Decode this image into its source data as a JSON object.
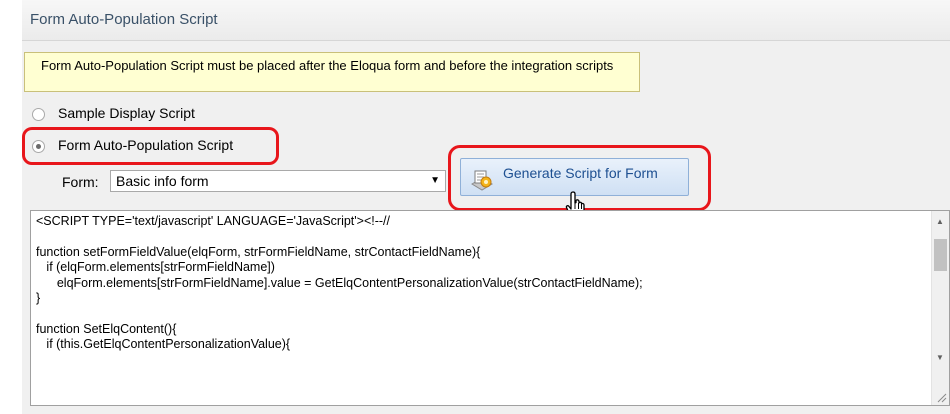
{
  "panel": {
    "title": "Form Auto-Population Script",
    "notice": "Form Auto-Population Script must be placed after the Eloqua form and before the integration scripts"
  },
  "options": {
    "sample_label": "Sample Display Script",
    "autopop_label": "Form Auto-Population Script",
    "selected": "autopop"
  },
  "form": {
    "label": "Form:",
    "selected_value": "Basic info form"
  },
  "generate_button": {
    "label": "Generate Script for Form"
  },
  "code": {
    "text": "<SCRIPT TYPE='text/javascript' LANGUAGE='JavaScript'><!--//\n\nfunction setFormFieldValue(elqForm, strFormFieldName, strContactFieldName){\n   if (elqForm.elements[strFormFieldName])\n      elqForm.elements[strFormFieldName].value = GetElqContentPersonalizationValue(strContactFieldName);\n}\n\nfunction SetElqContent(){\n   if (this.GetElqContentPersonalizationValue){"
  },
  "colors": {
    "highlight": "#e8161b",
    "notice_bg": "#ffffd2",
    "button_text": "#1d4f91"
  },
  "icons": {
    "generate": "script-gear-icon",
    "cursor": "hand-pointer-icon"
  }
}
